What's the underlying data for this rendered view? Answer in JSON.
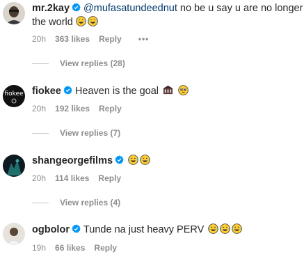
{
  "comments": [
    {
      "username": "mr.2kay",
      "mention": "@mufasatundeednut",
      "text_line1": " no be u say u are no longer in",
      "text_line2": "the world",
      "emojis": [
        "grinning-tears-emoji",
        "grinning-tears-emoji"
      ],
      "time": "20h",
      "likes": "363 likes",
      "reply": "Reply",
      "more": "•••",
      "view_replies": "View replies (28)"
    },
    {
      "username": "fiokee",
      "text": "Heaven is the goal",
      "emojis": [
        "church-emoji",
        "pleading-face-emoji"
      ],
      "time": "20h",
      "likes": "192 likes",
      "reply": "Reply",
      "view_replies": "View replies (7)"
    },
    {
      "username": "shangeorgefilms",
      "text": "",
      "emojis": [
        "grinning-tears-emoji",
        "grinning-tears-emoji"
      ],
      "time": "20h",
      "likes": "114 likes",
      "reply": "Reply",
      "view_replies": "View replies (4)"
    },
    {
      "username": "ogbolor",
      "text": "Tunde na just heavy PERV",
      "emojis": [
        "grinning-tears-emoji",
        "grinning-tears-emoji",
        "grinning-tears-emoji"
      ],
      "time": "19h",
      "likes": "66 likes",
      "reply": "Reply"
    }
  ],
  "colors": {
    "text": "#262626",
    "secondary": "#8e8e8e",
    "verified": "#0095f6",
    "mention": "#00376b"
  }
}
